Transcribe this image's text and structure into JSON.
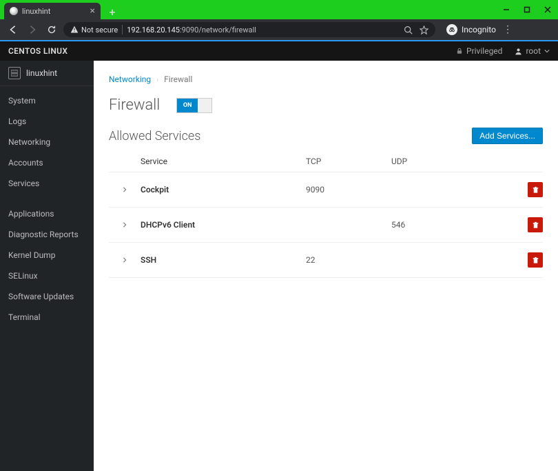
{
  "browser": {
    "tab_title": "linuxhint",
    "not_secure_label": "Not secure",
    "url_host": "192.168.20.145",
    "url_path": ":9090/network/firewall",
    "incognito_label": "Incognito"
  },
  "header": {
    "os_name": "CENTOS LINUX",
    "privileged_label": "Privileged",
    "user_label": "root"
  },
  "sidebar": {
    "host": "linuxhint",
    "items_primary": [
      "System",
      "Logs",
      "Networking",
      "Accounts",
      "Services"
    ],
    "items_secondary": [
      "Applications",
      "Diagnostic Reports",
      "Kernel Dump",
      "SELinux",
      "Software Updates",
      "Terminal"
    ]
  },
  "breadcrumb": {
    "link": "Networking",
    "current": "Firewall"
  },
  "page": {
    "title": "Firewall",
    "switch_label": "ON",
    "section_title": "Allowed Services",
    "add_button": "Add Services...",
    "columns": {
      "service": "Service",
      "tcp": "TCP",
      "udp": "UDP"
    },
    "services": [
      {
        "name": "Cockpit",
        "tcp": "9090",
        "udp": ""
      },
      {
        "name": "DHCPv6 Client",
        "tcp": "",
        "udp": "546"
      },
      {
        "name": "SSH",
        "tcp": "22",
        "udp": ""
      }
    ]
  }
}
